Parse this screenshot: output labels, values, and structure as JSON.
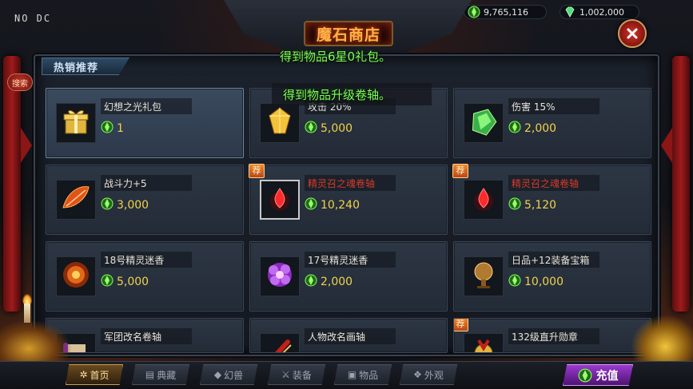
{
  "hud": {
    "debug_text": "NO DC"
  },
  "currency": {
    "gold": {
      "icon": "green-gem-icon",
      "value": "9,765,116"
    },
    "diamond": {
      "icon": "diamond-icon",
      "value": "1,002,000"
    }
  },
  "window": {
    "title": "魔石商店",
    "tab_label": "热销推荐",
    "search_label": "搜索"
  },
  "messages": {
    "line1": "得到物品6星0礼包。",
    "line2": "得到物品升级卷轴。"
  },
  "colors": {
    "price": "#f0d34a",
    "name_red": "#d43a2a",
    "message_green": "#7fff5a",
    "hot_badge": "#e07a25",
    "recharge": "#8a30c0"
  },
  "items": [
    {
      "name": "幻想之光礼包",
      "price": "1",
      "icon": "gift-box-icon",
      "hot": false,
      "selected": true,
      "red_name": false
    },
    {
      "name": "攻击 20%",
      "price": "5,000",
      "icon": "gold-crystal-icon",
      "hot": false,
      "selected": false,
      "red_name": false
    },
    {
      "name": "伤害 15%",
      "price": "2,000",
      "icon": "green-crystal-icon",
      "hot": false,
      "selected": false,
      "red_name": false
    },
    {
      "name": "战斗力+5",
      "price": "3,000",
      "icon": "fire-feather-icon",
      "hot": false,
      "selected": false,
      "red_name": false
    },
    {
      "name": "精灵召之魂卷轴",
      "price": "10,240",
      "icon": "blood-drop-icon",
      "hot": true,
      "selected": false,
      "red_name": true
    },
    {
      "name": "精灵召之魂卷轴",
      "price": "5,120",
      "icon": "blood-drop-icon",
      "hot": true,
      "selected": false,
      "red_name": true
    },
    {
      "name": "18号精灵迷香",
      "price": "5,000",
      "icon": "fire-orb-icon",
      "hot": false,
      "selected": false,
      "red_name": false
    },
    {
      "name": "17号精灵迷香",
      "price": "2,000",
      "icon": "purple-flower-icon",
      "hot": false,
      "selected": false,
      "red_name": false
    },
    {
      "name": "日品+12装备宝箱",
      "price": "10,000",
      "icon": "bronze-orb-icon",
      "hot": false,
      "selected": false,
      "red_name": false
    },
    {
      "name": "军团改名卷轴",
      "price": "",
      "icon": "scroll-icon",
      "hot": false,
      "selected": false,
      "red_name": false
    },
    {
      "name": "人物改名画轴",
      "price": "",
      "icon": "red-scroll-icon",
      "hot": false,
      "selected": false,
      "red_name": false
    },
    {
      "name": "132级直升勋章",
      "price": "",
      "icon": "medal-icon",
      "hot": true,
      "selected": false,
      "red_name": false
    }
  ],
  "hot_badge_label": "荐",
  "nav": {
    "tabs": [
      {
        "label": "首页",
        "icon": "pinwheel-icon",
        "active": true
      },
      {
        "label": "典藏",
        "icon": "book-icon",
        "active": false
      },
      {
        "label": "幻兽",
        "icon": "beast-icon",
        "active": false
      },
      {
        "label": "装备",
        "icon": "sword-icon",
        "active": false
      },
      {
        "label": "物品",
        "icon": "bag-icon",
        "active": false
      },
      {
        "label": "外观",
        "icon": "wing-icon",
        "active": false
      }
    ],
    "recharge_label": "充值"
  }
}
